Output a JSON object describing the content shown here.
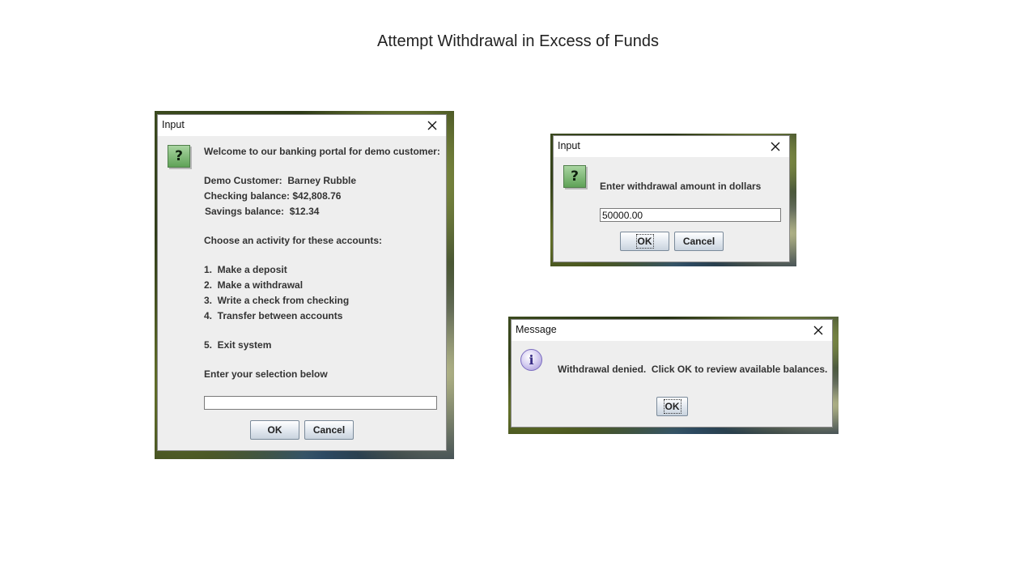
{
  "slide": {
    "title": "Attempt Withdrawal in Excess of Funds"
  },
  "dialog_menu": {
    "title": "Input",
    "icon": "question-icon",
    "lines": {
      "welcome": "Welcome to our banking portal for demo customer:",
      "customer": "Demo Customer:  Barney Rubble",
      "checking": "Checking balance: $42,808.76",
      "savings": "Savings balance:  $12.34",
      "choose": "Choose an activity for these accounts:",
      "opt1": "1.  Make a deposit",
      "opt2": "2.  Make a withdrawal",
      "opt3": "3.  Write a check from checking",
      "opt4": "4.  Transfer between accounts",
      "opt5": "5.  Exit system",
      "enter": "Enter your selection below"
    },
    "input_value": "",
    "ok_label": "OK",
    "cancel_label": "Cancel"
  },
  "dialog_amount": {
    "title": "Input",
    "icon": "question-icon",
    "prompt": "Enter withdrawal amount in dollars",
    "input_value": "50000.00",
    "ok_label": "OK",
    "cancel_label": "Cancel"
  },
  "dialog_message": {
    "title": "Message",
    "icon": "info-icon",
    "message": "Withdrawal denied.  Click OK to review available balances.",
    "ok_label": "OK"
  },
  "colors": {
    "dialog_bg": "#eeeeee",
    "titlebar_bg": "#ffffff",
    "question_icon": "#5fa257",
    "info_icon": "#9f90d6"
  }
}
